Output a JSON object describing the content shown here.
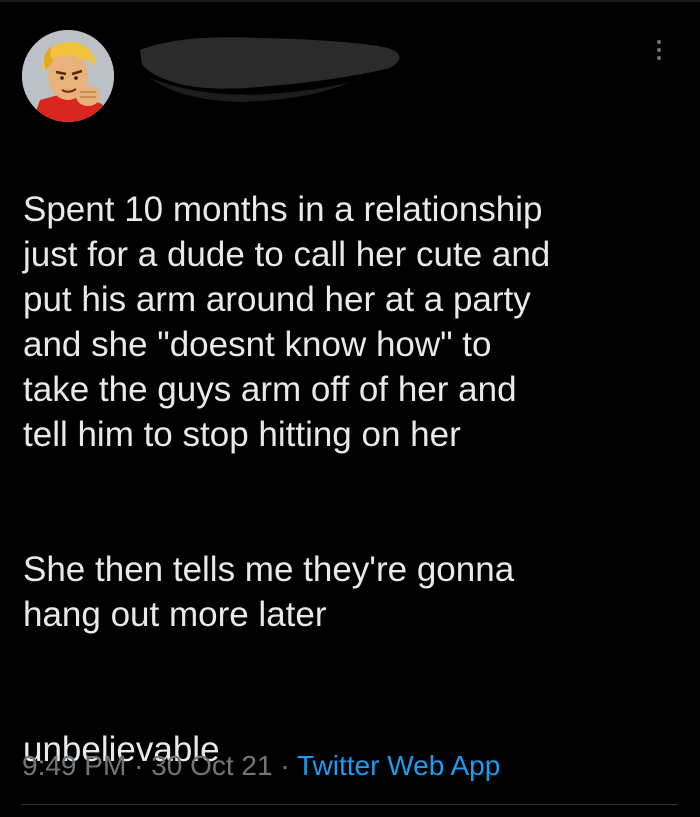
{
  "tweet": {
    "paragraphs": [
      "Spent 10 months in a relationship\njust for a dude to call her cute and\nput his arm around her at a party\nand she \"doesnt know how\" to\ntake the guys arm off of her and\ntell him to stop hitting on her",
      "She then tells me they're gonna\nhang out more later",
      "unbelievable"
    ],
    "time": "9:49 PM",
    "separator": "·",
    "date": "30 Oct 21",
    "source": "Twitter Web App"
  },
  "icons": {
    "avatar": "cartoon-fighter-avatar",
    "menu": "more-options-icon"
  },
  "colors": {
    "background": "#000000",
    "text": "#e7e9ea",
    "muted": "#71767b",
    "link": "#1d9bf0"
  }
}
